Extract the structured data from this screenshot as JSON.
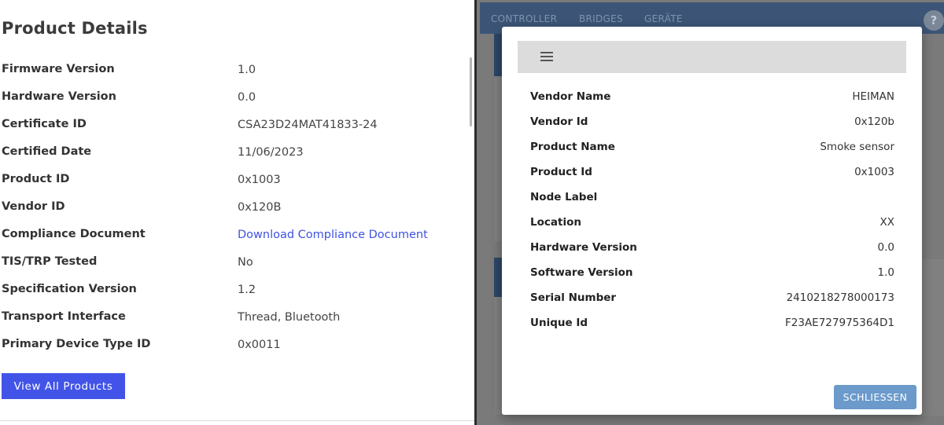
{
  "product_details": {
    "title": "Product Details",
    "rows": [
      {
        "label": "Firmware Version",
        "value": "1.0"
      },
      {
        "label": "Hardware Version",
        "value": "0.0"
      },
      {
        "label": "Certificate ID",
        "value": "CSA23D24MAT41833-24"
      },
      {
        "label": "Certified Date",
        "value": "11/06/2023"
      },
      {
        "label": "Product ID",
        "value": "0x1003"
      },
      {
        "label": "Vendor ID",
        "value": "0x120B"
      },
      {
        "label": "Compliance Document",
        "value": "Download Compliance Document"
      },
      {
        "label": "TIS/TRP Tested",
        "value": "No"
      },
      {
        "label": "Specification Version",
        "value": "1.2"
      },
      {
        "label": "Transport Interface",
        "value": "Thread, Bluetooth"
      },
      {
        "label": "Primary Device Type ID",
        "value": "0x0011"
      }
    ],
    "view_all_label": "View All Products"
  },
  "app": {
    "tabs": [
      "CONTROLLER",
      "BRIDGES",
      "GERÄTE"
    ],
    "help_label": "?"
  },
  "dialog": {
    "rows": [
      {
        "label": "Vendor Name",
        "value": "HEIMAN"
      },
      {
        "label": "Vendor Id",
        "value": "0x120b"
      },
      {
        "label": "Product Name",
        "value": "Smoke sensor"
      },
      {
        "label": "Product Id",
        "value": "0x1003"
      },
      {
        "label": "Node Label",
        "value": ""
      },
      {
        "label": "Location",
        "value": "XX"
      },
      {
        "label": "Hardware Version",
        "value": "0.0"
      },
      {
        "label": "Software Version",
        "value": "1.0"
      },
      {
        "label": "Serial Number",
        "value": "2410218278000173"
      },
      {
        "label": "Unique Id",
        "value": "F23AE727975364D1"
      }
    ],
    "close_label": "SCHLIESSEN"
  },
  "colors": {
    "accent_button": "#4254e8",
    "link": "#3f51e0",
    "appbar": "#3c5577",
    "close_button": "#6b9acb"
  }
}
